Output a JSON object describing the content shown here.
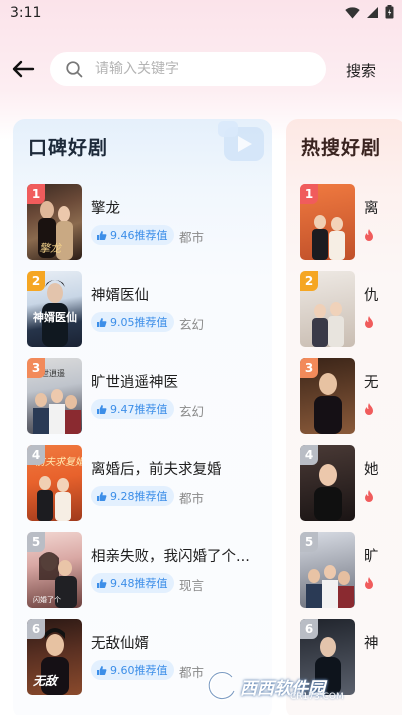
{
  "status_bar": {
    "time": "3:11"
  },
  "search": {
    "placeholder": "请输入关键字",
    "button_label": "搜索"
  },
  "colors": {
    "rank1": "#f05c5c",
    "rank2": "#f5a623",
    "rank3": "#f28a5a",
    "rank_other": "#b9bdc5",
    "score": "#3c8ee8"
  },
  "left_card": {
    "title": "口碑好剧",
    "items": [
      {
        "rank": "1",
        "title": "擎龙",
        "score": "9.46推荐值",
        "genre": "都市"
      },
      {
        "rank": "2",
        "title": "神婿医仙",
        "score": "9.05推荐值",
        "genre": "玄幻"
      },
      {
        "rank": "3",
        "title": "旷世逍遥神医",
        "score": "9.47推荐值",
        "genre": "玄幻"
      },
      {
        "rank": "4",
        "title": "离婚后，前夫求复婚",
        "score": "9.28推荐值",
        "genre": "都市"
      },
      {
        "rank": "5",
        "title": "相亲失败，我闪婚了个...",
        "score": "9.48推荐值",
        "genre": "现言"
      },
      {
        "rank": "6",
        "title": "无敌仙婿",
        "score": "9.60推荐值",
        "genre": "都市"
      }
    ]
  },
  "right_card": {
    "title": "热搜好剧",
    "items": [
      {
        "rank": "1",
        "title": "离"
      },
      {
        "rank": "2",
        "title": "仇"
      },
      {
        "rank": "3",
        "title": "无"
      },
      {
        "rank": "4",
        "title": "她"
      },
      {
        "rank": "5",
        "title": "旷"
      },
      {
        "rank": "6",
        "title": "神"
      }
    ]
  },
  "watermark": {
    "text": "西西软件园",
    "sub": "CR173.COM"
  }
}
